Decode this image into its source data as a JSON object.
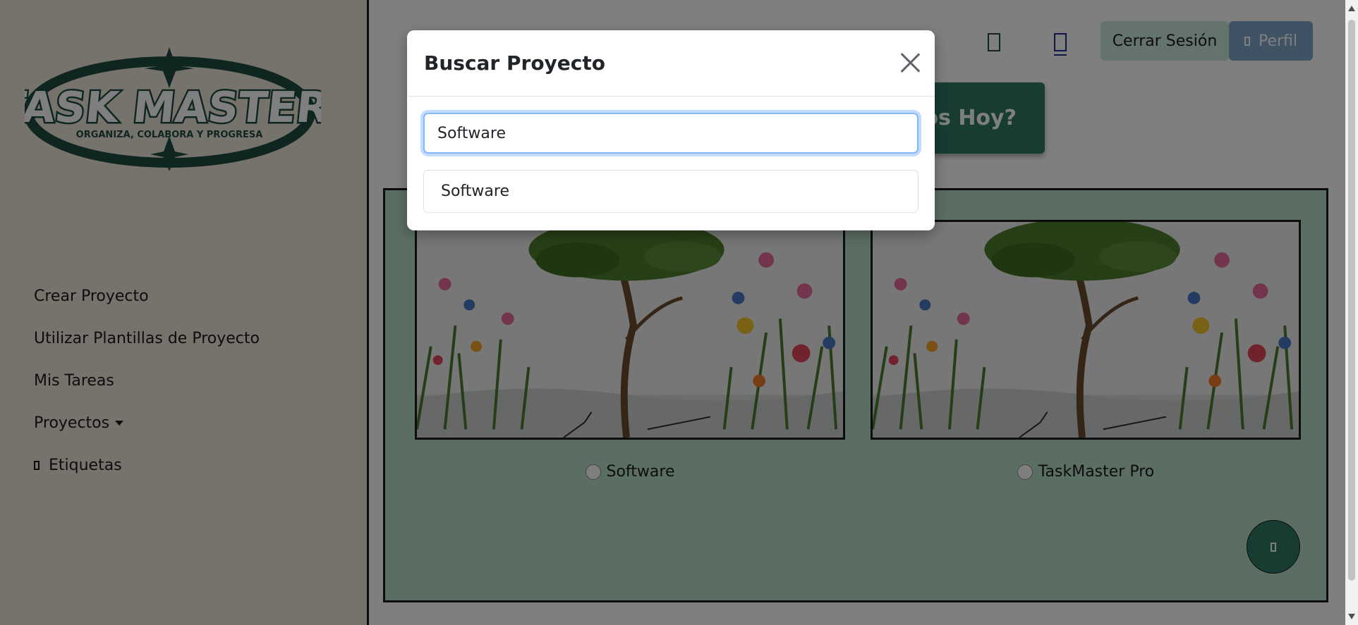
{
  "brand": {
    "logo_text": "TASK MASTER",
    "logo_tagline": "ORGANIZA, COLABORA Y PROGRESA"
  },
  "sidebar": {
    "items": [
      {
        "label": "Crear Proyecto"
      },
      {
        "label": "Utilizar Plantillas de Proyecto"
      },
      {
        "label": "Mis Tareas"
      },
      {
        "label": "Proyectos"
      },
      {
        "label": "Etiquetas"
      }
    ]
  },
  "header": {
    "logout_label": "Cerrar Sesión",
    "profile_label": "Perfil"
  },
  "greeting": {
    "visible_text": "nos Hoy?"
  },
  "projects": [
    {
      "name": "Software"
    },
    {
      "name": "TaskMaster Pro"
    }
  ],
  "modal": {
    "title": "Buscar Proyecto",
    "search_value": "Software",
    "results": [
      {
        "label": "Software"
      }
    ]
  },
  "colors": {
    "brand_green": "#2f7a66",
    "logo_green": "#1e4a3f",
    "sidebar_bg": "#ece7db",
    "panel_bg": "#b6dcc9",
    "logout_bg": "#c9e6d6",
    "profile_bg": "#7fa6c9",
    "focus_blue": "#86b7fe"
  }
}
